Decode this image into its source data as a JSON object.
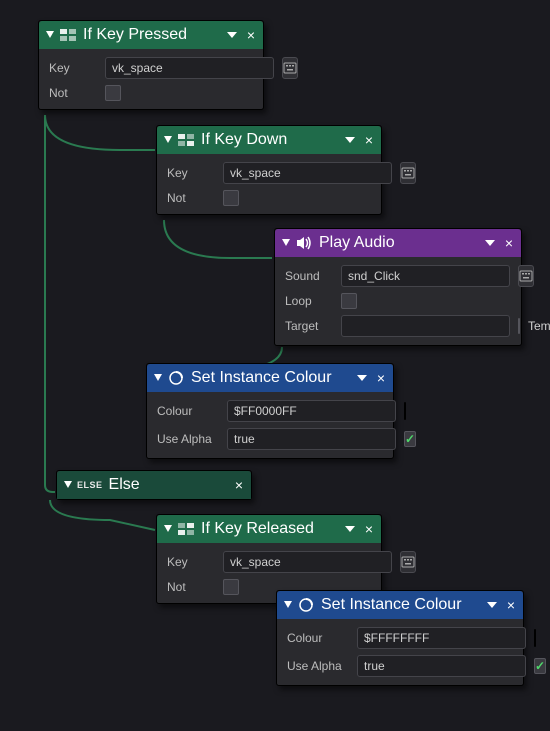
{
  "nodes": {
    "ifKeyPressed": {
      "title": "If Key Pressed",
      "key_label": "Key",
      "key_value": "vk_space",
      "not_label": "Not",
      "not_value": false
    },
    "ifKeyDown": {
      "title": "If Key Down",
      "key_label": "Key",
      "key_value": "vk_space",
      "not_label": "Not",
      "not_value": false
    },
    "playAudio": {
      "title": "Play Audio",
      "sound_label": "Sound",
      "sound_value": "snd_Click",
      "loop_label": "Loop",
      "loop_value": false,
      "target_label": "Target",
      "target_value": "",
      "temp_label": "Temp",
      "temp_value": false
    },
    "setColour1": {
      "title": "Set Instance Colour",
      "colour_label": "Colour",
      "colour_value": "$FF0000FF",
      "colour_swatch": "#FF0000",
      "alpha_label": "Use Alpha",
      "alpha_value": "true",
      "alpha_checked": true
    },
    "elseNode": {
      "else_label": "ELSE",
      "title": "Else"
    },
    "ifKeyReleased": {
      "title": "If Key Released",
      "key_label": "Key",
      "key_value": "vk_space",
      "not_label": "Not",
      "not_value": false
    },
    "setColour2": {
      "title": "Set Instance Colour",
      "colour_label": "Colour",
      "colour_value": "$FFFFFFFF",
      "colour_swatch": "#FFFFFF",
      "alpha_label": "Use Alpha",
      "alpha_value": "true",
      "alpha_checked": true
    }
  }
}
